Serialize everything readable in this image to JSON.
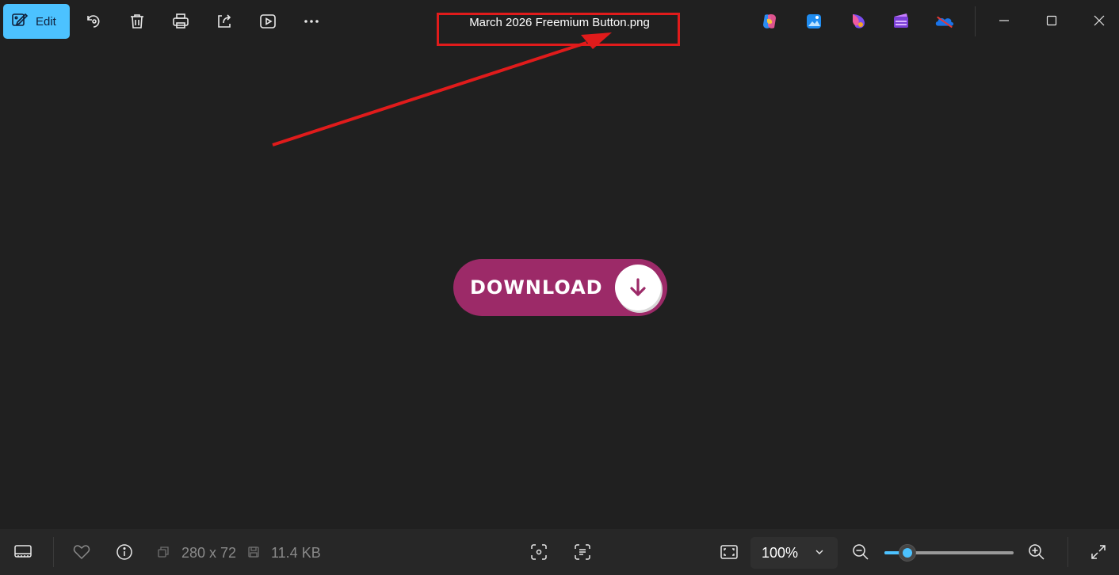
{
  "toolbar": {
    "edit_label": "Edit",
    "icons": [
      "edit-pencil-icon",
      "rotate-icon",
      "delete-icon",
      "print-icon",
      "share-icon",
      "slideshow-icon",
      "more-icon"
    ]
  },
  "title": "March 2026 Freemium Button.png",
  "annotation_color": "#e01b1b",
  "accent_color": "#4cc2ff",
  "app_icons": [
    "copilot-icon",
    "photos-editor-icon",
    "clipchamp-designer-icon",
    "clipchamp-icon",
    "onedrive-icon"
  ],
  "image": {
    "button_text": "DOWNLOAD",
    "button_color": "#9c2a68"
  },
  "status": {
    "dimensions": "280 x 72",
    "file_size": "11.4 KB",
    "zoom": "100%",
    "zoom_level": 0.18
  }
}
